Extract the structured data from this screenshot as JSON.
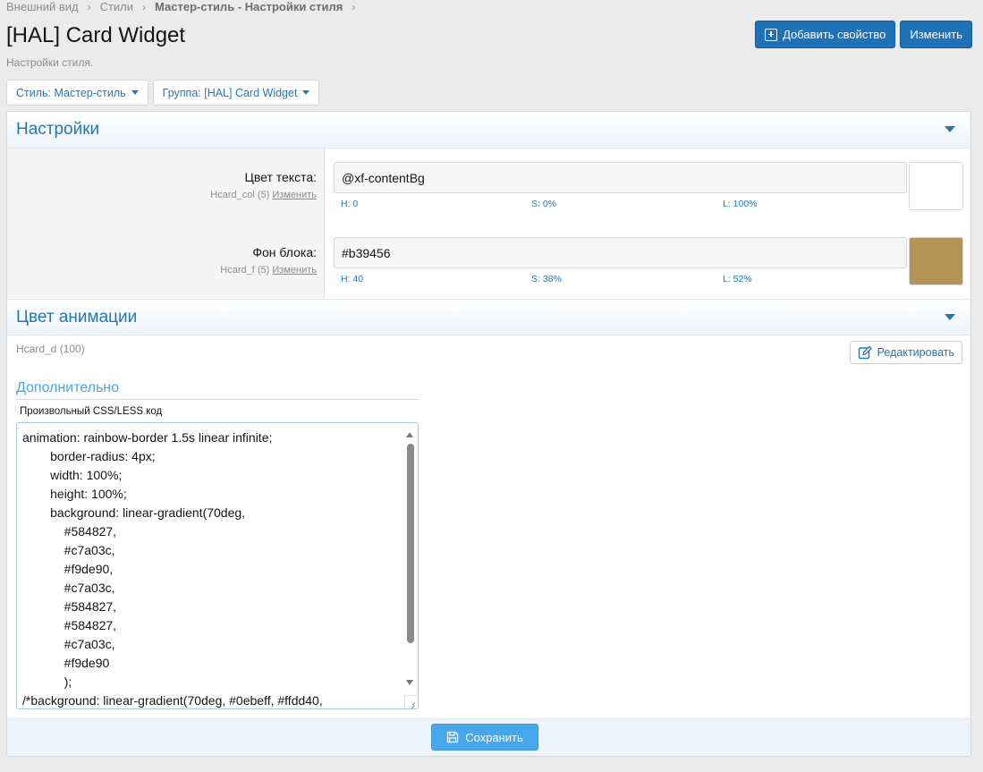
{
  "breadcrumb": [
    "Внешний вид",
    "Стили",
    "Мастер-стиль - Настройки стиля"
  ],
  "header": {
    "title": "[HAL] Card Widget",
    "description": "Настройки стиля.",
    "add_property_label": "Добавить свойство",
    "edit_label": "Изменить"
  },
  "filters": {
    "style_label": "Стиль: Мастер-стиль",
    "group_label": "Группа: [HAL] Card Widget"
  },
  "settings": {
    "title": "Настройки",
    "rows": [
      {
        "label": "Цвет текста:",
        "key": "Hcard_col (5)",
        "edit_link": "Изменить",
        "value": "@xf-contentBg",
        "h": "H: 0",
        "s": "S: 0%",
        "l": "L: 100%",
        "swatch_color": "#ffffff"
      },
      {
        "label": "Фон блока:",
        "key": "Hcard_f (5)",
        "edit_link": "Изменить",
        "value": "#b39456",
        "h": "H: 40",
        "s": "S: 38%",
        "l": "L: 52%",
        "swatch_color": "#b39456"
      }
    ]
  },
  "animation": {
    "title": "Цвет анимации",
    "key": "Hcard_d (100)",
    "edit_button": "Редактировать",
    "extra_title": "Дополнительно",
    "code_label": "Произвольный CSS/LESS код",
    "code": "animation: rainbow-border 1.5s linear infinite;\n\t\tborder-radius: 4px;\n\t\twidth: 100%;\n\t\theight: 100%;\n\t\tbackground: linear-gradient(70deg,\n\t\t    #584827,\n\t\t    #c7a03c,\n\t\t    #f9de90,\n\t\t    #c7a03c,\n\t\t    #584827,\n\t\t    #584827,\n\t\t    #c7a03c,\n\t\t    #f9de90\n\t\t    );\n/*background: linear-gradient(70deg, #0ebeff, #ffdd40,"
  },
  "footer": {
    "save_label": "Сохранить"
  },
  "colors": {
    "primary": "#1f71b8",
    "link": "#2577b1",
    "save": "#47a7eb"
  }
}
